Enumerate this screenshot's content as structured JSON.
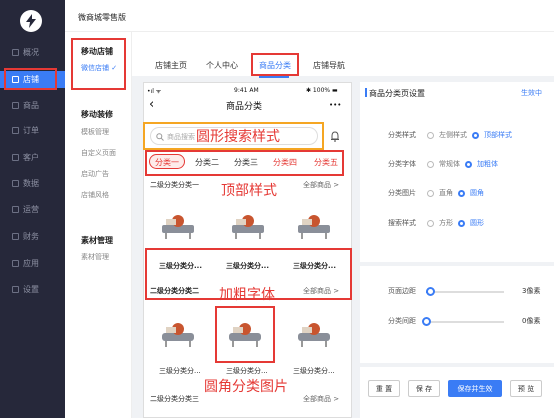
{
  "topbar": {
    "title": "微商城零售版"
  },
  "sidebar": {
    "items": [
      {
        "label": "概况"
      },
      {
        "label": "店铺"
      },
      {
        "label": "商品"
      },
      {
        "label": "订单"
      },
      {
        "label": "客户"
      },
      {
        "label": "数据"
      },
      {
        "label": "运营"
      },
      {
        "label": "财务"
      },
      {
        "label": "应用"
      },
      {
        "label": "设置"
      }
    ]
  },
  "subnav": {
    "mobile_store": "移动店铺",
    "wechat_store": "微信店铺 ✓",
    "decoration": "移动装修",
    "template": "模板管理",
    "custom_page": "自定义页面",
    "launch_ad": "启动广告",
    "style": "店铺风格",
    "materials": "素材管理",
    "material_mgmt": "素材管理"
  },
  "tabs": [
    {
      "label": "店铺主页"
    },
    {
      "label": "个人中心"
    },
    {
      "label": "商品分类"
    },
    {
      "label": "店铺导航"
    }
  ],
  "phone": {
    "signal": "•ıl ᯤ",
    "time": "9:41 AM",
    "battery": "✱ 100% ▬",
    "title": "商品分类",
    "more": "•••",
    "back": "‹",
    "search_placeholder": "商品搜索",
    "categories": [
      "分类一",
      "分类二",
      "分类三",
      "分类四",
      "分类五"
    ],
    "section1": "二级分类分类一",
    "section2": "二级分类分类二",
    "section3": "二级分类分类三",
    "all_products": "全部商品 >",
    "sub_category": "三级分类分..."
  },
  "annotations": {
    "search": "圆形搜索样式",
    "top": "顶部样式",
    "bold": "加粗字体",
    "corner": "圆角分类图片"
  },
  "panel": {
    "title": "商品分类页设置",
    "status": "生效中",
    "category_style": {
      "label": "分类样式",
      "options": [
        "左侧样式",
        "顶部样式"
      ]
    },
    "category_font": {
      "label": "分类字体",
      "options": [
        "常规体",
        "加粗体"
      ]
    },
    "category_image": {
      "label": "分类图片",
      "options": [
        "直角",
        "圆角"
      ]
    },
    "search_style": {
      "label": "搜索样式",
      "options": [
        "方形",
        "圆形"
      ]
    },
    "page_margin": {
      "label": "页面边距",
      "value": "3像素",
      "level": 0.05
    },
    "category_gap": {
      "label": "分类间距",
      "value": "0像素",
      "level": 0.0
    },
    "buttons": {
      "reset": "重 置",
      "save": "保 存",
      "publish": "保存并生效",
      "preview": "预 览"
    }
  },
  "colors": {
    "accent": "#3a7cf5",
    "sidebar": "#26283a",
    "annotation": "#e53935"
  }
}
